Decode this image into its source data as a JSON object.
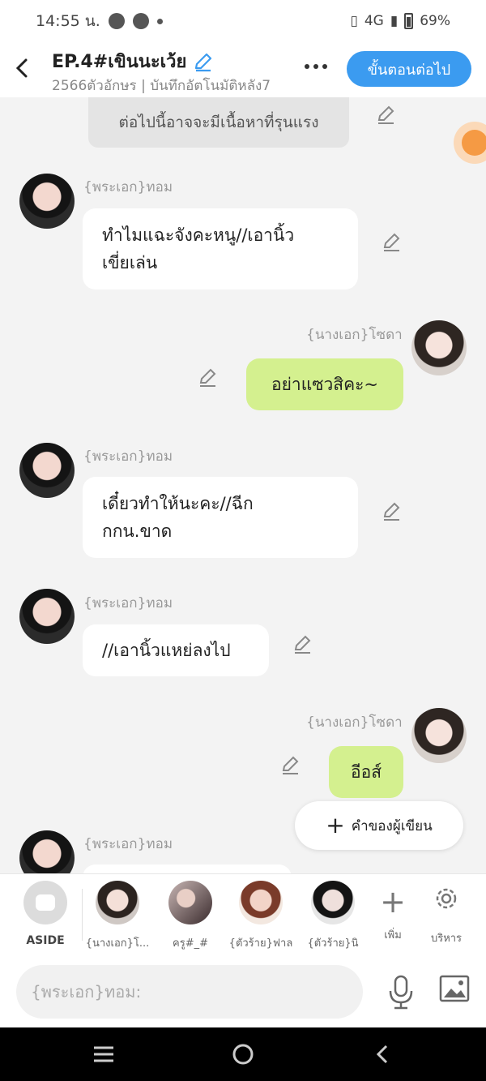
{
  "status_bar": {
    "time": "14:55 น.",
    "network": "4G",
    "battery": "69%"
  },
  "header": {
    "title": "EP.4#เขินนะเว้ย",
    "subtitle": "2566ตัวอักษร | บันทึกอัตโนมัติหลัง7",
    "next_label": "ขั้นตอนต่อไป"
  },
  "warning_text": "ต่อไปนี้อาจจะมีเนื้อหาที่รุนแรง",
  "messages": [
    {
      "speaker": "{พระเอก}ทอม",
      "text1": "ทำไมแฉะจังคะหนู//เอานิ้ว",
      "text2": "เขี่ยเล่น"
    },
    {
      "speaker": "{นางเอก}โซดา",
      "text": "อย่าแซวสิคะ~"
    },
    {
      "speaker": "{พระเอก}ทอม",
      "text1": "เดี๋ยวทำให้นะคะ//ฉีก",
      "text2": "กกน.ขาด"
    },
    {
      "speaker": "{พระเอก}ทอม",
      "text": "//เอานิ้วแหย่ลงไป"
    },
    {
      "speaker": "{นางเอก}โซดา",
      "text": "อีอส์"
    },
    {
      "speaker": "{พระเอก}ทอม"
    }
  ],
  "author_note_label": "คำของผู้เขียน",
  "char_bar": {
    "aside": "ASIDE",
    "chars": [
      "{นางเอก}โ...",
      "ครู#_#",
      "{ตัวร้าย}ฟาล",
      "{ตัวร้าย}นิ"
    ],
    "add": "เพิ่ม",
    "manage": "บริหาร"
  },
  "input": {
    "placeholder": "{พระเอก}ทอม:"
  }
}
